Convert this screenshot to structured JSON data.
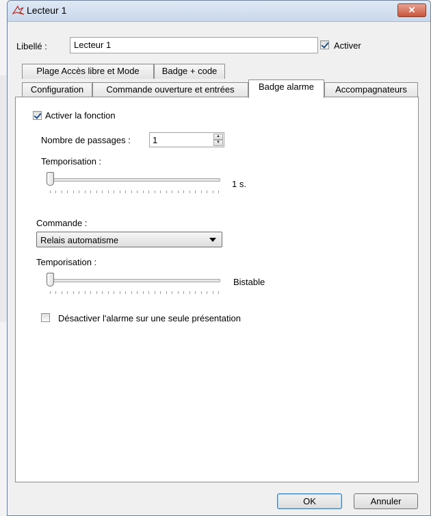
{
  "window": {
    "title": "Lecteur 1",
    "close_label": "✕"
  },
  "header": {
    "libelle_label": "Libellé :",
    "libelle_value": "Lecteur 1",
    "activer_label": "Activer",
    "activer_checked": true
  },
  "tabs": {
    "row1": [
      "Plage Accès libre et Mode",
      "Badge + code"
    ],
    "row2": [
      "Configuration",
      "Commande ouverture et entrées",
      "Badge alarme",
      "Accompagnateurs"
    ],
    "active": "Badge alarme"
  },
  "panel": {
    "activer_fonction_label": "Activer la fonction",
    "activer_fonction_checked": true,
    "nombre_passages_label": "Nombre de passages :",
    "nombre_passages_value": "1",
    "temporisation1_label": "Temporisation :",
    "temporisation1_value": "1 s.",
    "temporisation1_level": 0,
    "commande_label": "Commande :",
    "commande_value": "Relais automatisme",
    "temporisation2_label": "Temporisation :",
    "temporisation2_value": "Bistable",
    "temporisation2_level": 0,
    "desactiver_label": "Désactiver l'alarme sur une seule présentation",
    "desactiver_checked": false
  },
  "footer": {
    "ok_label": "OK",
    "cancel_label": "Annuler"
  },
  "icons": {
    "app": "reader-icon",
    "close": "close-icon",
    "spin_up": "arrow-up-icon",
    "spin_down": "arrow-down-icon",
    "dropdown": "chevron-down-icon"
  }
}
